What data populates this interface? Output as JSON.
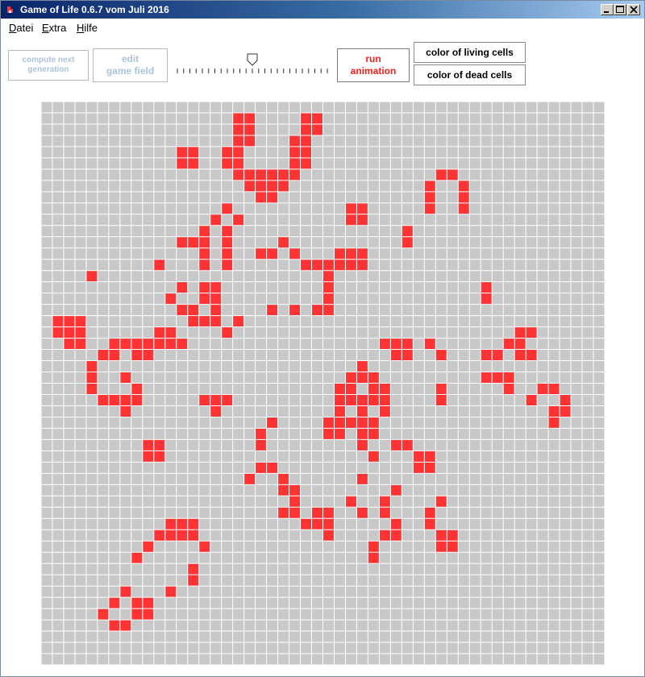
{
  "window": {
    "title": "Game of Life 0.6.7 vom Juli 2016",
    "controls": [
      "minimize-icon",
      "maximize-icon",
      "close-icon"
    ]
  },
  "menu": {
    "items": [
      {
        "label": "Datei",
        "accel": "D"
      },
      {
        "label": "Extra",
        "accel": "E"
      },
      {
        "label": "Hilfe",
        "accel": "H"
      }
    ]
  },
  "toolbar": {
    "compute_line1": "compute next",
    "compute_line2": "generation",
    "edit_line1": "edit",
    "edit_line2": "game field",
    "run_line1": "run",
    "run_line2": "animation",
    "living_color_label": "color of living cells",
    "dead_color_label": "color of dead cells",
    "speed_slider_value": 0.5
  },
  "colors": {
    "living": "#ff3333",
    "dead": "#c8c8c8",
    "gridline": "#ffffff",
    "disabled_text": "#a9c4dc",
    "run_text": "#ff1a1a"
  },
  "board": {
    "columns": 50,
    "rows": 50,
    "living_cells": [
      [
        1,
        17
      ],
      [
        1,
        18
      ],
      [
        1,
        23
      ],
      [
        1,
        24
      ],
      [
        2,
        17
      ],
      [
        2,
        18
      ],
      [
        2,
        23
      ],
      [
        2,
        24
      ],
      [
        3,
        17
      ],
      [
        3,
        18
      ],
      [
        3,
        22
      ],
      [
        3,
        23
      ],
      [
        4,
        12
      ],
      [
        4,
        13
      ],
      [
        4,
        16
      ],
      [
        4,
        17
      ],
      [
        4,
        22
      ],
      [
        4,
        23
      ],
      [
        5,
        12
      ],
      [
        5,
        13
      ],
      [
        5,
        16
      ],
      [
        5,
        17
      ],
      [
        5,
        22
      ],
      [
        5,
        23
      ],
      [
        6,
        17
      ],
      [
        6,
        18
      ],
      [
        6,
        19
      ],
      [
        6,
        20
      ],
      [
        6,
        21
      ],
      [
        6,
        22
      ],
      [
        6,
        35
      ],
      [
        6,
        36
      ],
      [
        7,
        18
      ],
      [
        7,
        19
      ],
      [
        7,
        20
      ],
      [
        7,
        21
      ],
      [
        7,
        34
      ],
      [
        7,
        37
      ],
      [
        8,
        19
      ],
      [
        8,
        20
      ],
      [
        8,
        34
      ],
      [
        8,
        37
      ],
      [
        9,
        16
      ],
      [
        9,
        27
      ],
      [
        9,
        28
      ],
      [
        9,
        34
      ],
      [
        9,
        37
      ],
      [
        10,
        15
      ],
      [
        10,
        17
      ],
      [
        10,
        27
      ],
      [
        10,
        28
      ],
      [
        11,
        14
      ],
      [
        11,
        16
      ],
      [
        11,
        32
      ],
      [
        12,
        12
      ],
      [
        12,
        13
      ],
      [
        12,
        14
      ],
      [
        12,
        16
      ],
      [
        12,
        21
      ],
      [
        12,
        32
      ],
      [
        13,
        14
      ],
      [
        13,
        16
      ],
      [
        13,
        19
      ],
      [
        13,
        20
      ],
      [
        13,
        22
      ],
      [
        13,
        26
      ],
      [
        13,
        27
      ],
      [
        13,
        28
      ],
      [
        14,
        10
      ],
      [
        14,
        14
      ],
      [
        14,
        16
      ],
      [
        14,
        23
      ],
      [
        14,
        24
      ],
      [
        14,
        25
      ],
      [
        14,
        26
      ],
      [
        14,
        27
      ],
      [
        14,
        28
      ],
      [
        15,
        4
      ],
      [
        15,
        25
      ],
      [
        16,
        12
      ],
      [
        16,
        14
      ],
      [
        16,
        15
      ],
      [
        16,
        25
      ],
      [
        16,
        39
      ],
      [
        17,
        11
      ],
      [
        17,
        14
      ],
      [
        17,
        15
      ],
      [
        17,
        25
      ],
      [
        17,
        39
      ],
      [
        18,
        12
      ],
      [
        18,
        13
      ],
      [
        18,
        15
      ],
      [
        18,
        20
      ],
      [
        18,
        22
      ],
      [
        18,
        24
      ],
      [
        18,
        25
      ],
      [
        19,
        1
      ],
      [
        19,
        2
      ],
      [
        19,
        3
      ],
      [
        19,
        13
      ],
      [
        19,
        14
      ],
      [
        19,
        15
      ],
      [
        19,
        17
      ],
      [
        20,
        1
      ],
      [
        20,
        2
      ],
      [
        20,
        3
      ],
      [
        20,
        10
      ],
      [
        20,
        11
      ],
      [
        20,
        16
      ],
      [
        20,
        42
      ],
      [
        20,
        43
      ],
      [
        21,
        2
      ],
      [
        21,
        3
      ],
      [
        21,
        6
      ],
      [
        21,
        7
      ],
      [
        21,
        8
      ],
      [
        21,
        9
      ],
      [
        21,
        10
      ],
      [
        21,
        11
      ],
      [
        21,
        12
      ],
      [
        21,
        30
      ],
      [
        21,
        31
      ],
      [
        21,
        32
      ],
      [
        21,
        34
      ],
      [
        21,
        41
      ],
      [
        21,
        42
      ],
      [
        22,
        5
      ],
      [
        22,
        6
      ],
      [
        22,
        8
      ],
      [
        22,
        9
      ],
      [
        22,
        31
      ],
      [
        22,
        32
      ],
      [
        22,
        35
      ],
      [
        22,
        39
      ],
      [
        22,
        40
      ],
      [
        22,
        42
      ],
      [
        22,
        43
      ],
      [
        23,
        4
      ],
      [
        23,
        28
      ],
      [
        24,
        4
      ],
      [
        24,
        7
      ],
      [
        24,
        27
      ],
      [
        24,
        28
      ],
      [
        24,
        29
      ],
      [
        24,
        39
      ],
      [
        24,
        40
      ],
      [
        24,
        41
      ],
      [
        25,
        4
      ],
      [
        25,
        8
      ],
      [
        25,
        26
      ],
      [
        25,
        27
      ],
      [
        25,
        29
      ],
      [
        25,
        30
      ],
      [
        25,
        35
      ],
      [
        25,
        41
      ],
      [
        25,
        44
      ],
      [
        25,
        45
      ],
      [
        26,
        5
      ],
      [
        26,
        6
      ],
      [
        26,
        7
      ],
      [
        26,
        8
      ],
      [
        26,
        14
      ],
      [
        26,
        15
      ],
      [
        26,
        16
      ],
      [
        26,
        26
      ],
      [
        26,
        27
      ],
      [
        26,
        28
      ],
      [
        26,
        29
      ],
      [
        26,
        30
      ],
      [
        26,
        35
      ],
      [
        26,
        43
      ],
      [
        26,
        46
      ],
      [
        27,
        7
      ],
      [
        27,
        15
      ],
      [
        27,
        26
      ],
      [
        27,
        28
      ],
      [
        27,
        30
      ],
      [
        27,
        45
      ],
      [
        27,
        46
      ],
      [
        28,
        20
      ],
      [
        28,
        25
      ],
      [
        28,
        26
      ],
      [
        28,
        27
      ],
      [
        28,
        28
      ],
      [
        28,
        29
      ],
      [
        28,
        45
      ],
      [
        29,
        19
      ],
      [
        29,
        25
      ],
      [
        29,
        26
      ],
      [
        29,
        28
      ],
      [
        29,
        29
      ],
      [
        30,
        9
      ],
      [
        30,
        10
      ],
      [
        30,
        19
      ],
      [
        30,
        28
      ],
      [
        30,
        31
      ],
      [
        30,
        32
      ],
      [
        31,
        9
      ],
      [
        31,
        10
      ],
      [
        31,
        29
      ],
      [
        31,
        33
      ],
      [
        31,
        34
      ],
      [
        32,
        19
      ],
      [
        32,
        20
      ],
      [
        32,
        33
      ],
      [
        32,
        34
      ],
      [
        33,
        18
      ],
      [
        33,
        21
      ],
      [
        33,
        28
      ],
      [
        34,
        21
      ],
      [
        34,
        22
      ],
      [
        34,
        31
      ],
      [
        35,
        22
      ],
      [
        35,
        27
      ],
      [
        35,
        30
      ],
      [
        35,
        35
      ],
      [
        36,
        21
      ],
      [
        36,
        22
      ],
      [
        36,
        24
      ],
      [
        36,
        25
      ],
      [
        36,
        28
      ],
      [
        36,
        30
      ],
      [
        36,
        34
      ],
      [
        37,
        11
      ],
      [
        37,
        12
      ],
      [
        37,
        13
      ],
      [
        37,
        23
      ],
      [
        37,
        24
      ],
      [
        37,
        25
      ],
      [
        37,
        31
      ],
      [
        37,
        34
      ],
      [
        38,
        10
      ],
      [
        38,
        11
      ],
      [
        38,
        12
      ],
      [
        38,
        13
      ],
      [
        38,
        25
      ],
      [
        38,
        30
      ],
      [
        38,
        31
      ],
      [
        38,
        35
      ],
      [
        38,
        36
      ],
      [
        39,
        9
      ],
      [
        39,
        14
      ],
      [
        39,
        29
      ],
      [
        39,
        35
      ],
      [
        39,
        36
      ],
      [
        40,
        8
      ],
      [
        40,
        29
      ],
      [
        41,
        13
      ],
      [
        42,
        13
      ],
      [
        43,
        7
      ],
      [
        43,
        11
      ],
      [
        44,
        6
      ],
      [
        44,
        8
      ],
      [
        44,
        9
      ],
      [
        45,
        5
      ],
      [
        45,
        8
      ],
      [
        45,
        9
      ],
      [
        46,
        6
      ],
      [
        46,
        7
      ]
    ]
  }
}
